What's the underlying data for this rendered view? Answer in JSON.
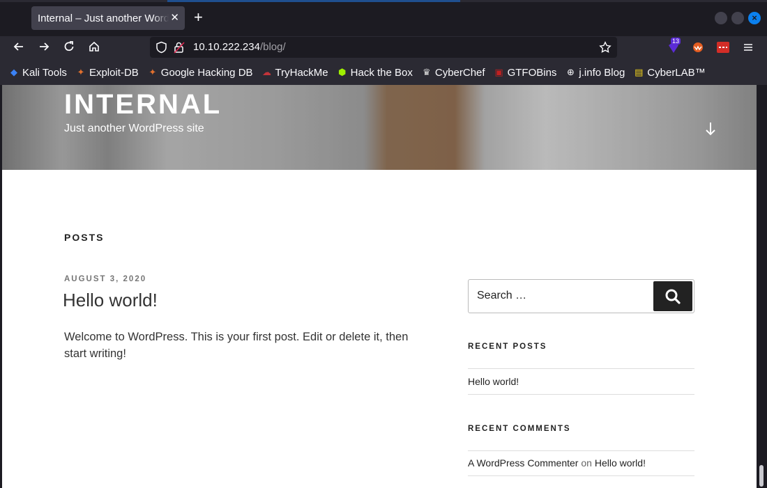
{
  "browser": {
    "tab_title": "Internal – Just another WordPress site",
    "tab_close": "✕",
    "new_tab": "+",
    "url_host": "10.10.222.234",
    "url_path": "/blog/",
    "extension_badge": "13"
  },
  "bookmarks": [
    {
      "label": "Kali Tools",
      "icon": "kali-icon",
      "color": "#3b82f6"
    },
    {
      "label": "Exploit-DB",
      "icon": "exploitdb-icon",
      "color": "#e2702e"
    },
    {
      "label": "Google Hacking DB",
      "icon": "ghdb-icon",
      "color": "#e2702e"
    },
    {
      "label": "TryHackMe",
      "icon": "tryhackme-icon",
      "color": "#c3343a"
    },
    {
      "label": "Hack the Box",
      "icon": "htb-icon",
      "color": "#9fef00"
    },
    {
      "label": "CyberChef",
      "icon": "cyberchef-icon",
      "color": "#dddddd"
    },
    {
      "label": "GTFOBins",
      "icon": "gtfobins-icon",
      "color": "#c02020"
    },
    {
      "label": "j.info Blog",
      "icon": "globe-icon",
      "color": "#fbfbfe"
    },
    {
      "label": "CyberLAB™",
      "icon": "cyberlab-icon",
      "color": "#f2d21b"
    }
  ],
  "site": {
    "title": "INTERNAL",
    "description": "Just another WordPress site"
  },
  "main": {
    "section_heading": "POSTS",
    "post": {
      "date": "AUGUST 3, 2020",
      "title": "Hello world!",
      "excerpt": "Welcome to WordPress. This is your first post. Edit or delete it, then start writing!"
    }
  },
  "sidebar": {
    "search_placeholder": "Search …",
    "recent_posts_heading": "RECENT POSTS",
    "recent_posts": [
      "Hello world!"
    ],
    "recent_comments_heading": "RECENT COMMENTS",
    "recent_comment": {
      "author": "A WordPress Commenter",
      "on": "on",
      "post": "Hello world!"
    }
  }
}
